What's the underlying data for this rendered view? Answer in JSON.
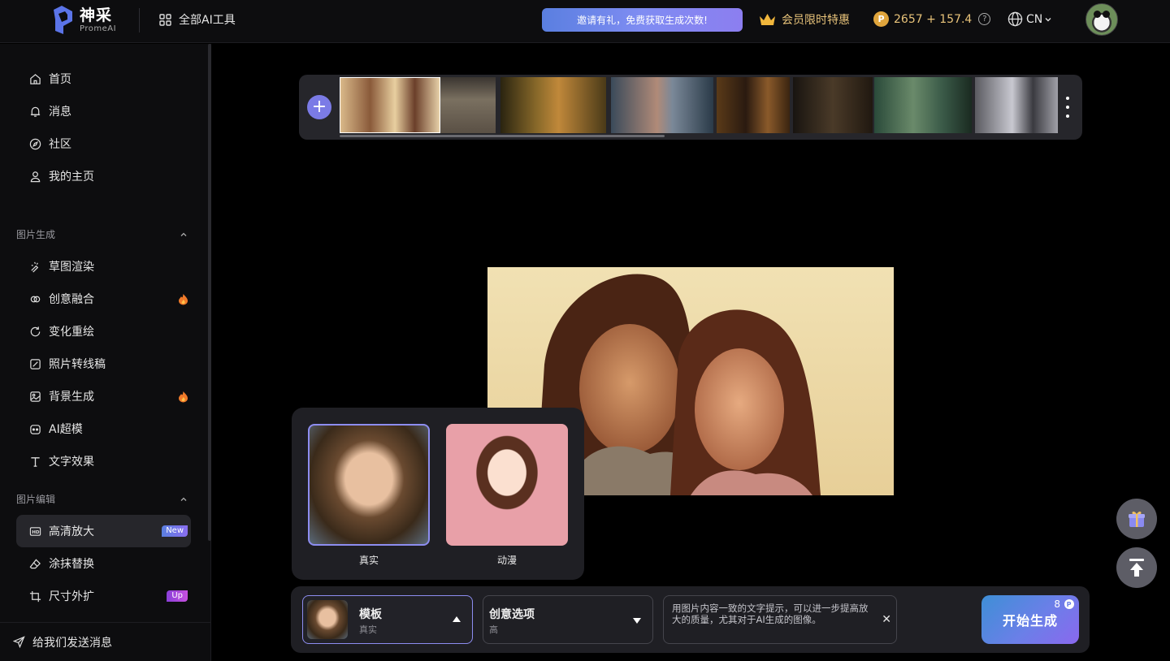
{
  "header": {
    "logo_cn": "神采",
    "logo_en": "PromeAI",
    "all_tools": "全部AI工具",
    "invite": "邀请有礼，免费获取生成次数!",
    "vip": "会员限时特惠",
    "credits": "2657 + 157.4",
    "lang": "CN"
  },
  "sidebar": {
    "top_items": [
      {
        "label": "首页",
        "icon": "home-icon"
      },
      {
        "label": "消息",
        "icon": "bell-icon"
      },
      {
        "label": "社区",
        "icon": "compass-icon"
      },
      {
        "label": "我的主页",
        "icon": "user-icon"
      }
    ],
    "section_gen": "图片生成",
    "gen_items": [
      {
        "label": "草图渲染",
        "icon": "sketch-icon"
      },
      {
        "label": "创意融合",
        "icon": "blend-icon",
        "badge": "fire"
      },
      {
        "label": "变化重绘",
        "icon": "refresh-icon"
      },
      {
        "label": "照片转线稿",
        "icon": "edit-icon"
      },
      {
        "label": "背景生成",
        "icon": "image-icon",
        "badge": "fire"
      },
      {
        "label": "AI超模",
        "icon": "robot-icon"
      },
      {
        "label": "文字效果",
        "icon": "text-icon"
      }
    ],
    "section_edit": "图片编辑",
    "edit_items": [
      {
        "label": "高清放大",
        "icon": "hd-icon",
        "badge": "New",
        "active": true
      },
      {
        "label": "涂抹替换",
        "icon": "eraser-icon"
      },
      {
        "label": "尺寸外扩",
        "icon": "crop-icon",
        "badge": "Up"
      }
    ],
    "feedback": "给我们发送消息"
  },
  "templates": {
    "options": [
      {
        "label": "真实",
        "selected": true
      },
      {
        "label": "动漫",
        "selected": false
      }
    ]
  },
  "bottom_bar": {
    "template_title": "模板",
    "template_value": "真实",
    "creative_title": "创意选项",
    "creative_value": "高",
    "prompt_text": "用图片内容一致的文字提示，可以进一步提高放大的质量，尤其对于AI生成的图像。",
    "generate_label": "开始生成",
    "generate_cost": "8"
  },
  "colors": {
    "accent": "#7b7be6",
    "gold": "#e8c37a",
    "background": "#000000"
  }
}
